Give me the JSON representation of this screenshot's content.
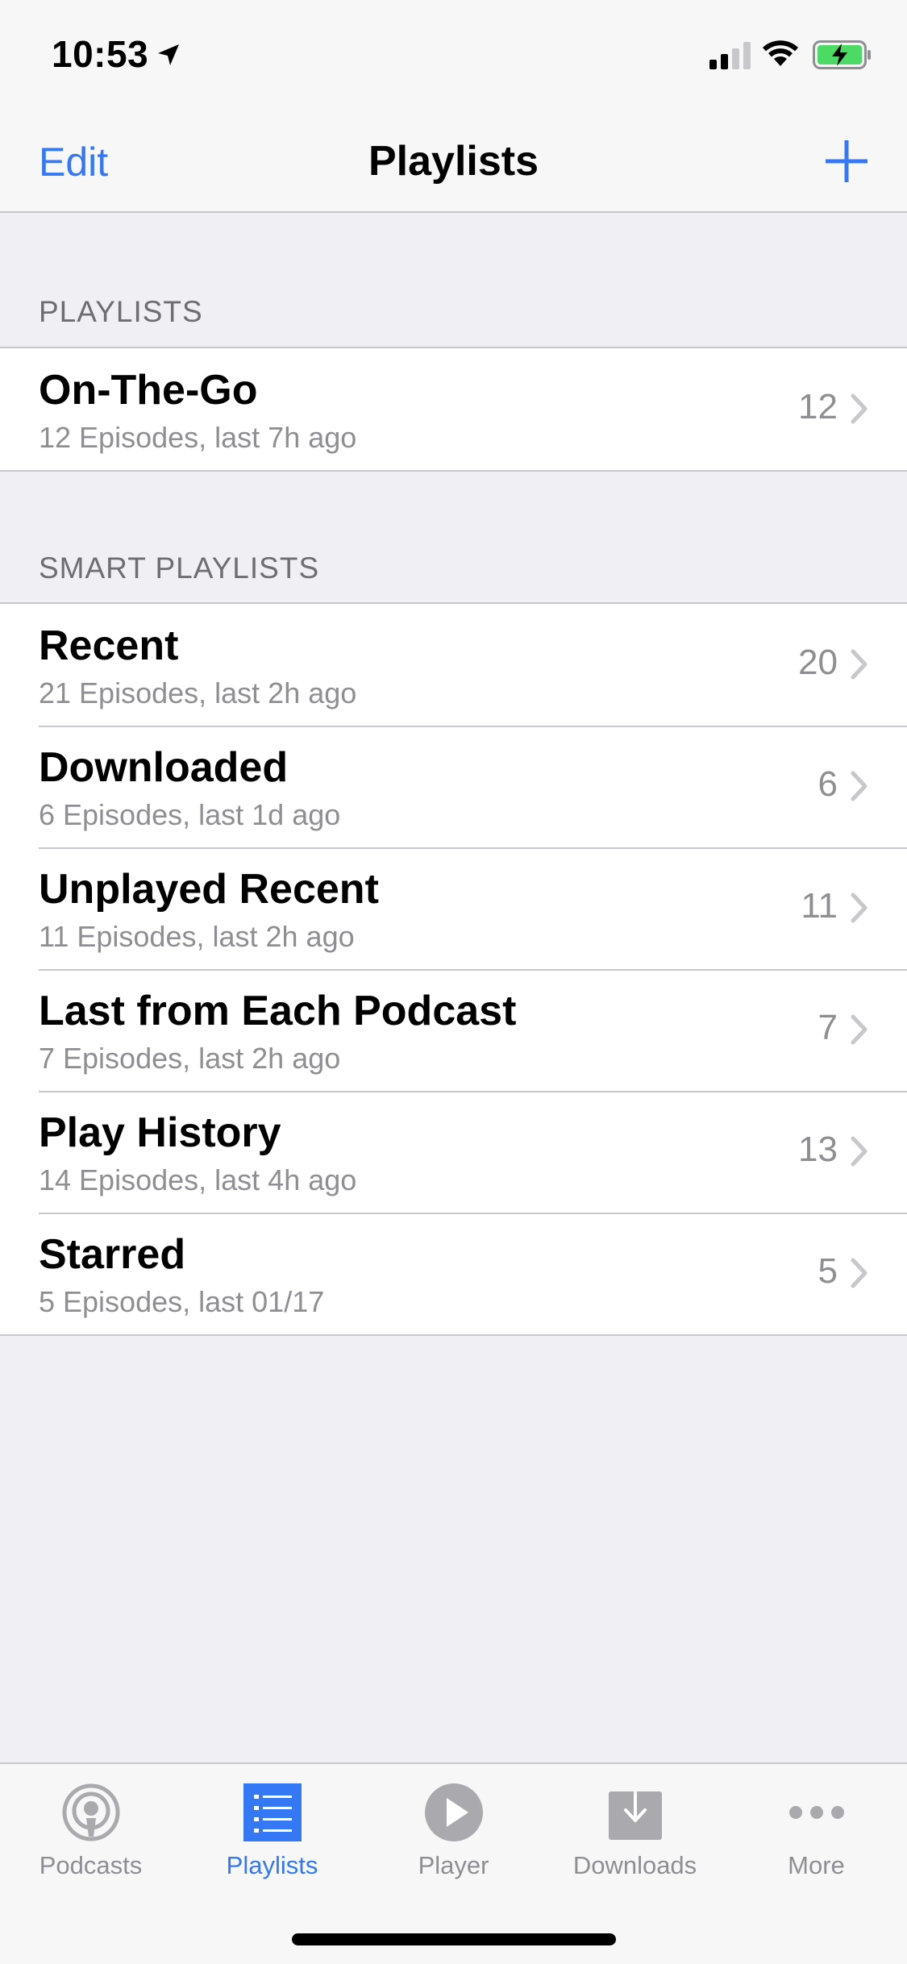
{
  "status_bar": {
    "time": "10:53",
    "icons": [
      "location-arrow-icon",
      "cellular-signal-icon",
      "wifi-icon",
      "battery-charging-icon"
    ],
    "battery_color": "#4cd964"
  },
  "nav": {
    "edit_label": "Edit",
    "title": "Playlists",
    "add_icon": "plus-icon"
  },
  "colors": {
    "accent": "#3478f6",
    "secondary_text": "#8e8e93",
    "background": "#efeff4"
  },
  "playlists_section": {
    "header": "PLAYLISTS",
    "items": [
      {
        "title": "On-The-Go",
        "subtitle": "12 Episodes, last 7h ago",
        "count": "12"
      }
    ]
  },
  "smart_section": {
    "header": "SMART PLAYLISTS",
    "items": [
      {
        "title": "Recent",
        "subtitle": "21 Episodes, last 2h ago",
        "count": "20"
      },
      {
        "title": "Downloaded",
        "subtitle": "6 Episodes, last 1d ago",
        "count": "6"
      },
      {
        "title": "Unplayed Recent",
        "subtitle": "11 Episodes, last 2h ago",
        "count": "11"
      },
      {
        "title": "Last from Each Podcast",
        "subtitle": "7 Episodes, last 2h ago",
        "count": "7"
      },
      {
        "title": "Play History",
        "subtitle": "14 Episodes, last 4h ago",
        "count": "13"
      },
      {
        "title": "Starred",
        "subtitle": "5 Episodes, last 01/17",
        "count": "5"
      }
    ]
  },
  "tabbar": {
    "tabs": [
      {
        "label": "Podcasts",
        "icon": "podcasts-icon",
        "active": false
      },
      {
        "label": "Playlists",
        "icon": "playlists-icon",
        "active": true
      },
      {
        "label": "Player",
        "icon": "play-icon",
        "active": false
      },
      {
        "label": "Downloads",
        "icon": "downloads-icon",
        "active": false
      },
      {
        "label": "More",
        "icon": "more-icon",
        "active": false
      }
    ]
  }
}
